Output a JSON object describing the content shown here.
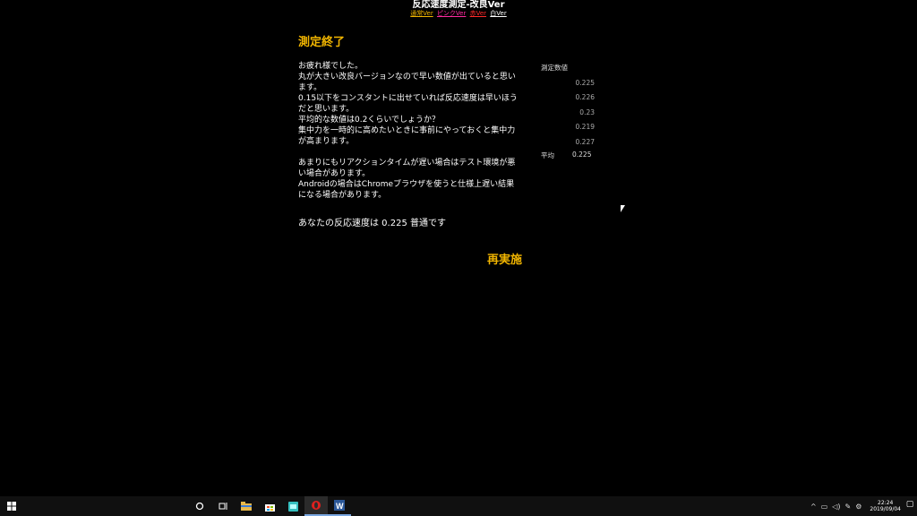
{
  "header": {
    "title": "反応速度測定-改良Ver",
    "links": [
      {
        "label": "通常Ver",
        "color": "#f0b400"
      },
      {
        "label": "ピンクVer",
        "color": "#ff2aa0"
      },
      {
        "label": "赤Ver",
        "color": "#ff2a2a"
      },
      {
        "label": "白Ver",
        "color": "#ffffff"
      }
    ]
  },
  "main": {
    "heading": "測定終了",
    "message_lines": [
      "お疲れ様でした。",
      "丸が大きい改良バージョンなので早い数値が出ていると思います。",
      "0.15以下をコンスタントに出せていれば反応速度は早いほうだと思います。",
      "平均的な数値は0.2くらいでしょうか？",
      "集中力を一時的に高めたいときに事前にやっておくと集中力が高まります。"
    ],
    "note_lines": [
      "あまりにもリアクションタイムが遅い場合はテスト環境が悪い場合があります。",
      "Androidの場合はChromeブラウザを使うと仕様上遅い結果になる場合があります。"
    ],
    "result_text": "あなたの反応速度は 0.225 普通です",
    "retry_label": "再実施"
  },
  "results": {
    "title": "測定数値",
    "values": [
      "0.225",
      "0.226",
      "0.23",
      "0.219",
      "0.227"
    ],
    "average_label": "平均",
    "average_value": "0.225"
  },
  "taskbar": {
    "icons": [
      "windows-start-icon",
      "cortana-circle-icon",
      "task-view-icon",
      "file-explorer-icon",
      "store-icon",
      "app-icon",
      "opera-icon",
      "word-icon"
    ],
    "clock_time": "22:24",
    "clock_date": "2019/09/04"
  }
}
